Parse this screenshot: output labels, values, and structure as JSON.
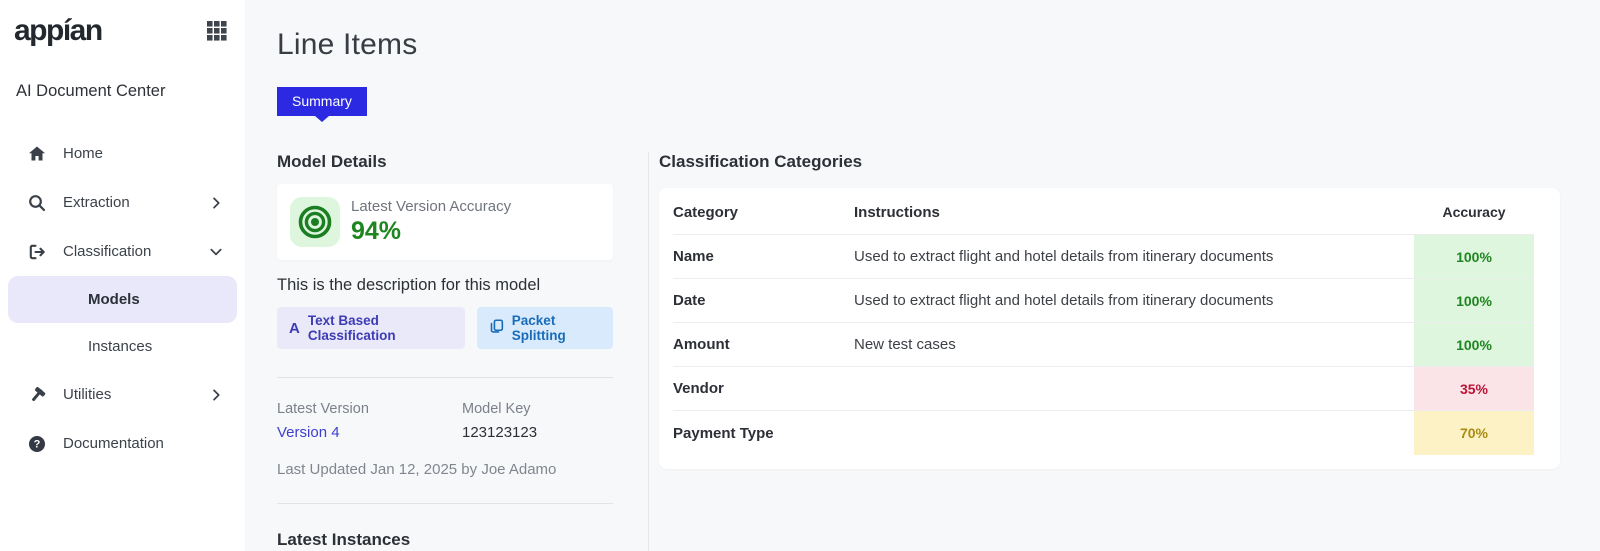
{
  "colors": {
    "accent": "#2b2ae2",
    "link": "#3e3ecf",
    "stat_green": "#1f861f",
    "green_bg": "#def5de",
    "green_text": "#1f861f",
    "red_bg": "#fbe4e7",
    "red_text": "#bb1237",
    "yellow_bg": "#fdf2c5",
    "yellow_text": "#a88d12",
    "sidebar_selected_bg": "#e9e8fa",
    "tag_purple_bg": "#eae9f9",
    "tag_purple_fg": "#3d3cb4",
    "tag_blue_bg": "#d8eafc",
    "tag_blue_fg": "#1a6cb8"
  },
  "sidebar": {
    "logo_text": "appían",
    "app_title": "AI Document Center",
    "items": [
      {
        "label": "Home"
      },
      {
        "label": "Extraction"
      },
      {
        "label": "Classification"
      },
      {
        "label": "Models"
      },
      {
        "label": "Instances"
      },
      {
        "label": "Utilities"
      },
      {
        "label": "Documentation"
      }
    ]
  },
  "header": {
    "title": "Line Items",
    "tab_label": "Summary"
  },
  "model_details": {
    "heading": "Model Details",
    "accuracy_label": "Latest Version Accuracy",
    "accuracy_value": "94%",
    "description": "This is the description for this model",
    "tags": [
      {
        "label": "Text Based Classification",
        "icon": "letter-a-icon"
      },
      {
        "label": "Packet Splitting",
        "icon": "copy-pages-icon"
      }
    ],
    "latest_version_label": "Latest Version",
    "latest_version_value": "Version 4",
    "model_key_label": "Model Key",
    "model_key_value": "123123123",
    "last_updated": "Last Updated Jan 12, 2025 by Joe Adamo"
  },
  "latest_instances": {
    "heading": "Latest Instances"
  },
  "categories": {
    "heading": "Classification Categories",
    "columns": [
      "Category",
      "Instructions",
      "Accuracy"
    ],
    "rows": [
      {
        "category": "Name",
        "instructions": "Used to extract flight and hotel details from itinerary documents",
        "accuracy": "100%",
        "level": "high"
      },
      {
        "category": "Date",
        "instructions": "Used to extract flight and hotel details from itinerary documents",
        "accuracy": "100%",
        "level": "high"
      },
      {
        "category": "Amount",
        "instructions": "New test cases",
        "accuracy": "100%",
        "level": "high"
      },
      {
        "category": "Vendor",
        "instructions": "",
        "accuracy": "35%",
        "level": "low"
      },
      {
        "category": "Payment Type",
        "instructions": "",
        "accuracy": "70%",
        "level": "medium"
      }
    ]
  }
}
